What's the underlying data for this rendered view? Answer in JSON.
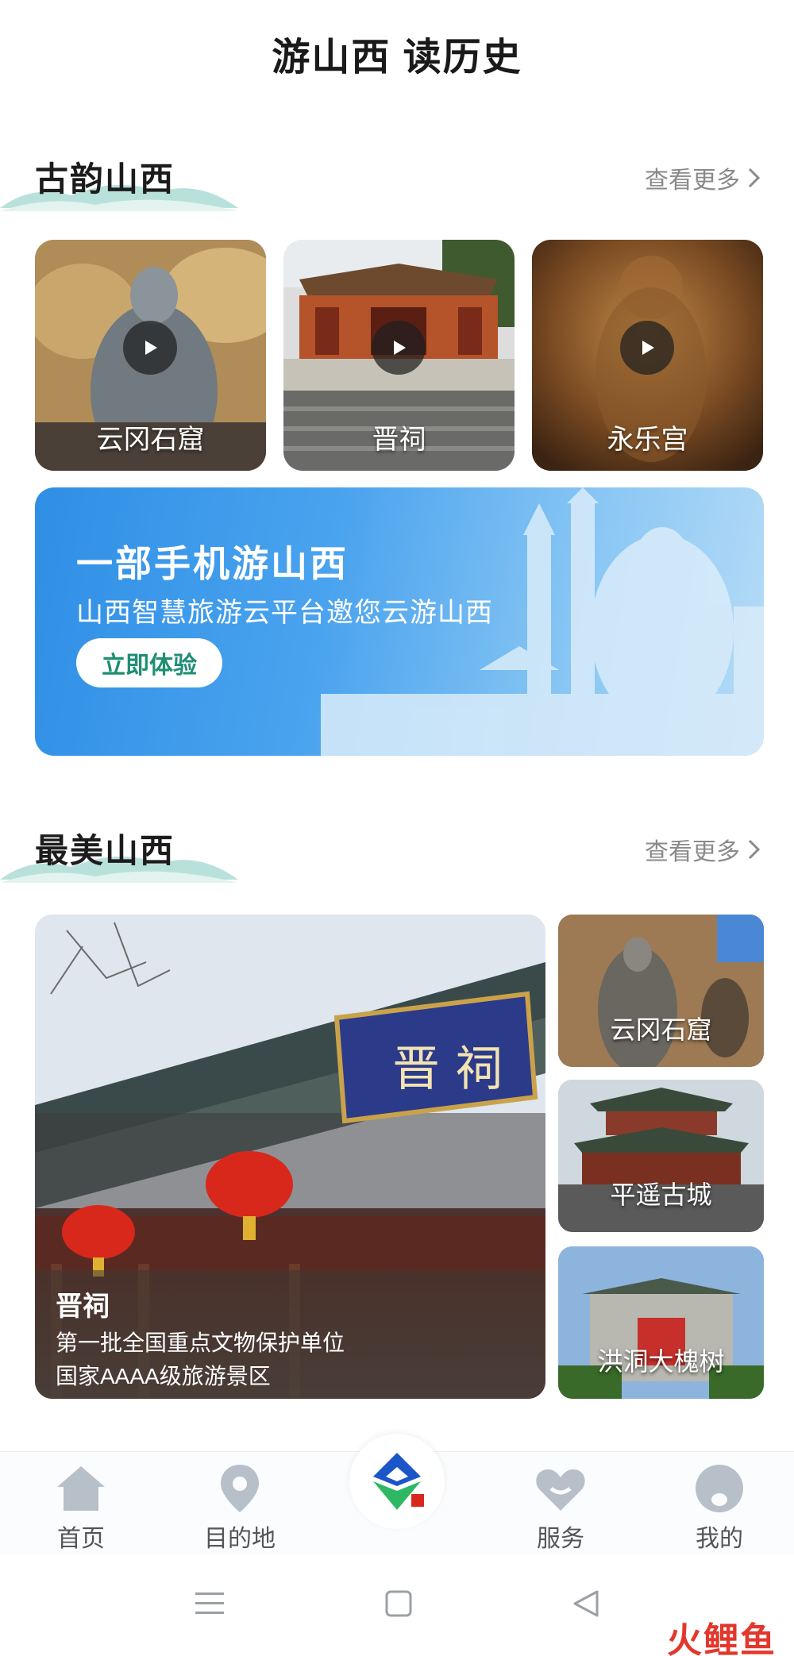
{
  "page_title": "游山西 读历史",
  "section1": {
    "title": "古韵山西",
    "more": "查看更多",
    "cards": [
      {
        "label": "云冈石窟"
      },
      {
        "label": "晋祠"
      },
      {
        "label": "永乐宫"
      }
    ]
  },
  "banner": {
    "title": "一部手机游山西",
    "subtitle": "山西智慧旅游云平台邀您云游山西",
    "button": "立即体验"
  },
  "section2": {
    "title": "最美山西",
    "more": "查看更多",
    "featured": {
      "name": "晋祠",
      "desc1": "第一批全国重点文物保护单位",
      "desc2": "国家AAAA级旅游景区",
      "plaque": "晋 祠"
    },
    "side_cards": [
      {
        "label": "云冈石窟"
      },
      {
        "label": "平遥古城"
      },
      {
        "label": "洪洞大槐树"
      }
    ]
  },
  "tabbar": {
    "items": [
      {
        "label": "首页",
        "icon": "home-icon"
      },
      {
        "label": "目的地",
        "icon": "location-pin-icon"
      },
      {
        "label": "",
        "icon": "app-logo-icon"
      },
      {
        "label": "服务",
        "icon": "heart-icon"
      },
      {
        "label": "我的",
        "icon": "profile-icon"
      }
    ]
  },
  "watermark": "火鲤鱼",
  "colors": {
    "accent_teal": "#1f8e73",
    "banner_blue": "#2f8fe6",
    "wave_teal": "#8fd0c8"
  }
}
